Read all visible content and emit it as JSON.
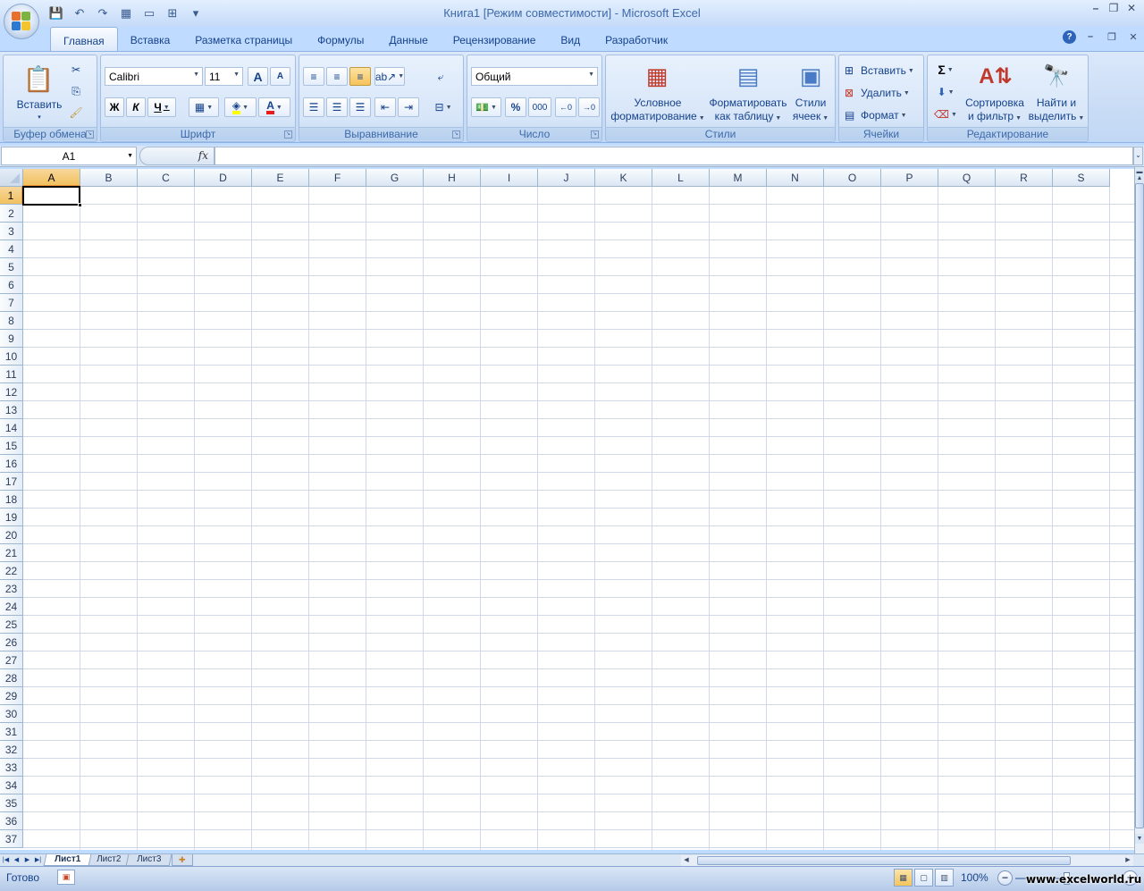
{
  "window": {
    "title": "Книга1  [Режим совместимости] - Microsoft Excel",
    "controls": {
      "minimize": "–",
      "restore": "❐",
      "close": "✕"
    }
  },
  "qat": {
    "save_icon": "💾",
    "undo_icon": "↶",
    "redo_icon": "↷",
    "sep": "▾"
  },
  "tabs": [
    {
      "label": "Главная",
      "active": true
    },
    {
      "label": "Вставка"
    },
    {
      "label": "Разметка страницы"
    },
    {
      "label": "Формулы"
    },
    {
      "label": "Данные"
    },
    {
      "label": "Рецензирование"
    },
    {
      "label": "Вид"
    },
    {
      "label": "Разработчик"
    }
  ],
  "ribbon": {
    "clipboard": {
      "label": "Буфер обмена",
      "paste": "Вставить"
    },
    "font": {
      "label": "Шрифт",
      "family": "Calibri",
      "size": "11",
      "bold": "Ж",
      "italic": "К",
      "underline": "Ч",
      "grow": "A",
      "shrink": "A"
    },
    "alignment": {
      "label": "Выравнивание"
    },
    "number": {
      "label": "Число",
      "format": "Общий",
      "percent": "%",
      "thousands": "000"
    },
    "styles": {
      "label": "Стили",
      "conditional_line1": "Условное",
      "conditional_line2": "форматирование",
      "as_table_line1": "Форматировать",
      "as_table_line2": "как таблицу",
      "cell_styles_line1": "Стили",
      "cell_styles_line2": "ячеек"
    },
    "cells": {
      "label": "Ячейки",
      "insert": "Вставить",
      "delete": "Удалить",
      "format": "Формат"
    },
    "editing": {
      "label": "Редактирование",
      "sort_line1": "Сортировка",
      "sort_line2": "и фильтр",
      "find_line1": "Найти и",
      "find_line2": "выделить",
      "sum": "Σ"
    }
  },
  "formula_bar": {
    "name_box": "A1",
    "fx": "fx",
    "value": ""
  },
  "columns": [
    "A",
    "B",
    "C",
    "D",
    "E",
    "F",
    "G",
    "H",
    "I",
    "J",
    "K",
    "L",
    "M",
    "N",
    "O",
    "P",
    "Q",
    "R",
    "S"
  ],
  "rows": [
    "1",
    "2",
    "3",
    "4",
    "5",
    "6",
    "7",
    "8",
    "9",
    "10",
    "11",
    "12",
    "13",
    "14",
    "15",
    "16",
    "17",
    "18",
    "19",
    "20",
    "21",
    "22",
    "23",
    "24",
    "25",
    "26",
    "27",
    "28",
    "29",
    "30",
    "31",
    "32",
    "33",
    "34",
    "35",
    "36",
    "37"
  ],
  "selected_cell": {
    "column": "A",
    "row": "1"
  },
  "sheets": [
    {
      "label": "Лист1",
      "active": true
    },
    {
      "label": "Лист2"
    },
    {
      "label": "Лист3"
    }
  ],
  "status": {
    "text": "Готово",
    "zoom": "100%"
  },
  "watermark": "www.excelworld.ru"
}
